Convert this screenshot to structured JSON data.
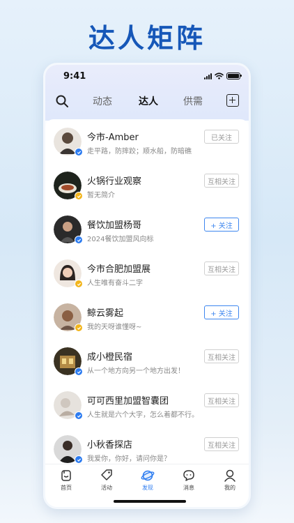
{
  "headline": "达人矩阵",
  "status_bar": {
    "time": "9:41"
  },
  "nav": {
    "tabs": [
      {
        "label": "动态",
        "active": false
      },
      {
        "label": "达人",
        "active": true
      },
      {
        "label": "供需",
        "active": false
      }
    ],
    "icons": [
      "search-icon",
      "add-square-icon"
    ]
  },
  "users": [
    {
      "name": "今市-Amber",
      "bio": "走平路，防摔跤；顺水船，防暗礁",
      "button": "已关注",
      "button_style": "muted",
      "badge": "blue",
      "avatar_color": "#5b4a3d"
    },
    {
      "name": "火锅行业观察",
      "bio": "暂无简介",
      "button": "互相关注",
      "button_style": "muted",
      "badge": "gold",
      "avatar_color": "#2f3b2c"
    },
    {
      "name": "餐饮加盟杨哥",
      "bio": "2024餐饮加盟风向标",
      "button": "+ 关注",
      "button_style": "primary",
      "badge": "blue",
      "avatar_color": "#2b2b2b"
    },
    {
      "name": "今市合肥加盟展",
      "bio": "人生唯有奋斗二字",
      "button": "互相关注",
      "button_style": "muted",
      "badge": "gold",
      "avatar_color": "#c9a48a"
    },
    {
      "name": "鲸云雾起",
      "bio": "我的天呀谁懂呀~",
      "button": "+ 关注",
      "button_style": "primary",
      "badge": "gold",
      "avatar_color": "#a07a5e"
    },
    {
      "name": "成小橙民宿",
      "bio": "从一个地方向另一个地方出发！",
      "button": "互相关注",
      "button_style": "muted",
      "badge": "blue",
      "avatar_color": "#6b5b3a"
    },
    {
      "name": "可可西里加盟智囊团",
      "bio": "人生就是六个大字，怎么着都不行。",
      "button": "互相关注",
      "button_style": "muted",
      "badge": "blue",
      "avatar_color": "#d9d4cf"
    },
    {
      "name": "小秋香探店",
      "bio": "我爱你，你好，请问你是？",
      "button": "互相关注",
      "button_style": "muted",
      "badge": "blue",
      "avatar_color": "#1f1f1f"
    }
  ],
  "tabbar": [
    {
      "label": "首页",
      "icon": "home-icon",
      "active": false
    },
    {
      "label": "活动",
      "icon": "tag-icon",
      "active": false
    },
    {
      "label": "发现",
      "icon": "planet-icon",
      "active": true
    },
    {
      "label": "消息",
      "icon": "message-icon",
      "active": false
    },
    {
      "label": "我的",
      "icon": "profile-icon",
      "active": false
    }
  ],
  "colors": {
    "brand": "#1657b8",
    "accent": "#2d7cf0",
    "gold": "#f2b51d"
  }
}
